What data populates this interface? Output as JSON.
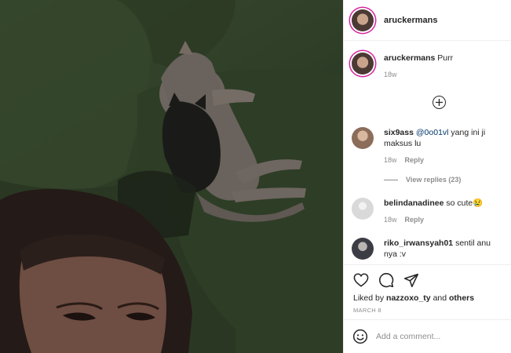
{
  "post": {
    "author": "aruckermans",
    "caption": "Purr",
    "caption_time": "18w",
    "likes_prefix": "Liked by",
    "liked_user": "nazzoxo_ty",
    "likes_and": "and",
    "likes_others": "others",
    "date": "MARCH 8"
  },
  "comments": [
    {
      "user": "six9ass",
      "mention": "@0o01vl",
      "text": "yang ini ji maksus lu",
      "time": "18w",
      "reply_label": "Reply",
      "view_replies": "View replies (23)"
    },
    {
      "user": "belindanadinee",
      "text": "so cute😢",
      "time": "18w",
      "reply_label": "Reply"
    },
    {
      "user": "riko_irwansyah01",
      "text": "sentil anu nya :v"
    }
  ],
  "composer": {
    "placeholder": "Add a comment..."
  },
  "icons": {
    "load_more": "plus-circle-icon",
    "like": "heart-icon",
    "comment": "comment-bubble-icon",
    "share": "paper-plane-icon",
    "emoji": "smiley-icon"
  },
  "colors": {
    "story_ring": "#d6249f",
    "mention": "#00376b",
    "secondary_text": "#8e8e8e"
  }
}
